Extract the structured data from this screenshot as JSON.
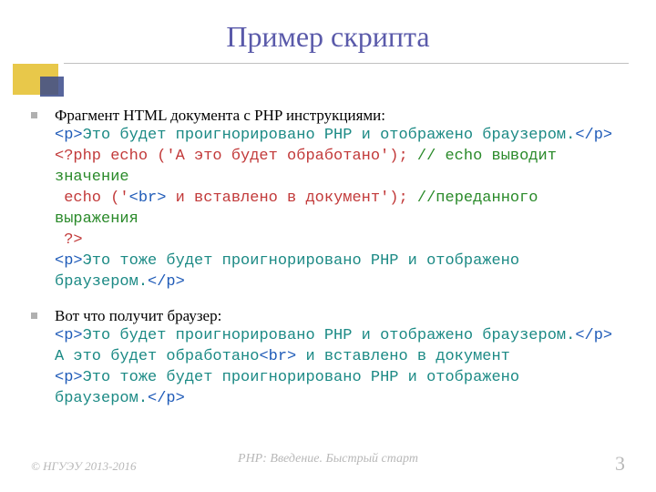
{
  "title": "Пример скрипта",
  "bullet1": {
    "intro": "Фрагмент HTML документа с PHP инструкциями:",
    "l1a": "<p>",
    "l1b": "Это будет проигнорировано PHP и отображено браузером.",
    "l1c": "</p>",
    "l2a": "<?php echo ('А это будет обработано');",
    "l2b": " // echo выводит значение",
    "l3a": " echo ('",
    "l3b": "<br>",
    "l3c": " и вставлено в документ');",
    "l3d": " //переданного выражения",
    "l4a": " ?>",
    "l5a": "<p>",
    "l5b": "Это тоже будет проигнорировано PHP и отображено браузером.",
    "l5c": "</p>"
  },
  "bullet2": {
    "intro": "Вот что получит браузер:",
    "l1a": "<p>",
    "l1b": "Это будет проигнорировано PHP и отображено браузером.",
    "l1c": "</p>",
    "l2a": "А это будет обработано",
    "l2b": "<br>",
    "l2c": " и вставлено в документ",
    "l3a": "<p>",
    "l3b": "Это тоже будет проигнорировано PHP и отображено браузером.",
    "l3c": "</p>"
  },
  "footer": {
    "copyright": "© НГУЭУ 2013-2016",
    "subtitle": "PHP: Введение. Быстрый старт",
    "page": "3"
  }
}
